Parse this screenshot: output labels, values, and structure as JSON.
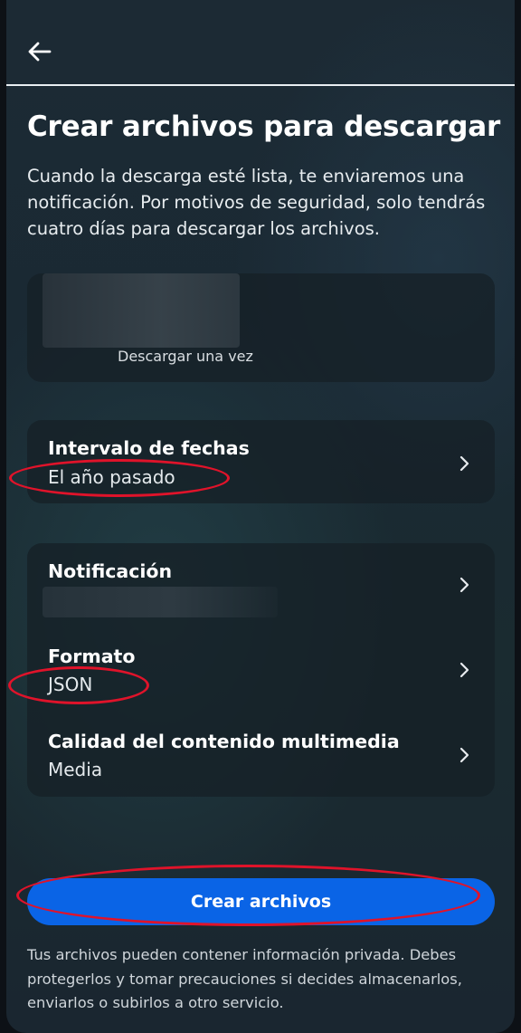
{
  "header": {
    "back_icon": "arrow-left-icon"
  },
  "title": "Crear archivos para descargar",
  "description": "Cuando la descarga esté lista, te enviaremos una notificación. Por motivos de seguridad, solo tendrás cuatro días para descargar los archivos.",
  "account_card": {
    "subtitle": "Descargar una vez"
  },
  "date_range": {
    "label": "Intervalo de fechas",
    "value": "El año pasado"
  },
  "options": {
    "notification": {
      "label": "Notificación"
    },
    "format": {
      "label": "Formato",
      "value": "JSON"
    },
    "media_quality": {
      "label": "Calidad del contenido multimedia",
      "value": "Media"
    }
  },
  "primary_button": {
    "label": "Crear archivos"
  },
  "footer": "Tus archivos pueden contener información privada. Debes protegerlos y tomar precauciones si decides almacenarlos, enviarlos o subirlos a otro servicio.",
  "colors": {
    "accent": "#0a64e6",
    "annotation": "#e0132a"
  }
}
